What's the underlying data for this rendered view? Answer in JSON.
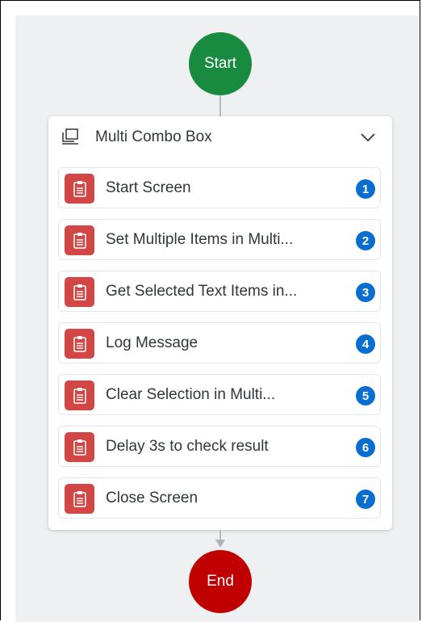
{
  "start_node": {
    "label": "Start",
    "color": "#188b41"
  },
  "end_node": {
    "label": "End",
    "color": "#c00000"
  },
  "group": {
    "title": "Multi Combo Box",
    "icon": "screen-icon",
    "collapse_icon": "chevron-down-icon"
  },
  "steps": [
    {
      "label": "Start Screen",
      "number": "1",
      "icon": "clipboard-icon"
    },
    {
      "label": "Set Multiple Items in Multi...",
      "number": "2",
      "icon": "clipboard-icon"
    },
    {
      "label": "Get Selected Text Items in...",
      "number": "3",
      "icon": "clipboard-icon"
    },
    {
      "label": "Log Message",
      "number": "4",
      "icon": "clipboard-icon"
    },
    {
      "label": "Clear Selection in Multi...",
      "number": "5",
      "icon": "clipboard-icon"
    },
    {
      "label": "Delay 3s to check result",
      "number": "6",
      "icon": "clipboard-icon"
    },
    {
      "label": "Close Screen",
      "number": "7",
      "icon": "clipboard-icon"
    }
  ],
  "colors": {
    "step_icon_bg": "#d24646",
    "badge_bg": "#0a6ed1",
    "canvas_bg": "#eff0f2"
  }
}
